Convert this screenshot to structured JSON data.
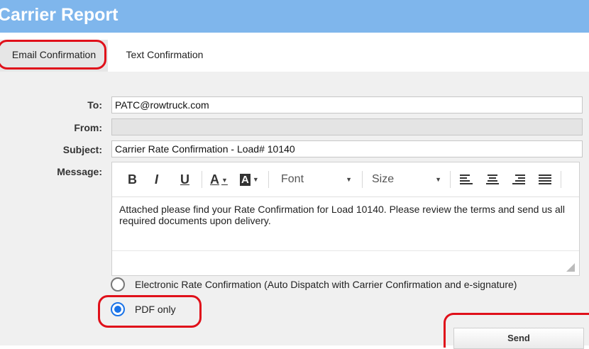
{
  "header": {
    "title": "Carrier Report"
  },
  "tabs": [
    {
      "label": "Email Confirmation",
      "active": true
    },
    {
      "label": "Text Confirmation",
      "active": false
    }
  ],
  "form": {
    "to_label": "To:",
    "to_value": "PATC@rowtruck.com",
    "from_label": "From:",
    "from_value": "",
    "subject_label": "Subject:",
    "subject_value": "Carrier Rate Confirmation - Load# 10140",
    "message_label": "Message:"
  },
  "toolbar": {
    "bold": "B",
    "italic": "I",
    "underline": "U",
    "font_color": "A",
    "highlight": "A",
    "font_select": "Font",
    "size_select": "Size"
  },
  "message": {
    "body": "Attached please find your Rate Confirmation for Load 10140. Please review the terms and send us all required documents upon delivery."
  },
  "options": [
    {
      "label": "Electronic Rate Confirmation (Auto Dispatch with Carrier Confirmation and e-signature)",
      "checked": false
    },
    {
      "label": "PDF only",
      "checked": true
    }
  ],
  "send_button": {
    "label": "Send"
  },
  "colors": {
    "header_bg": "#7fb6ec",
    "accent": "#1a73e8",
    "annotation": "#e0101a"
  }
}
